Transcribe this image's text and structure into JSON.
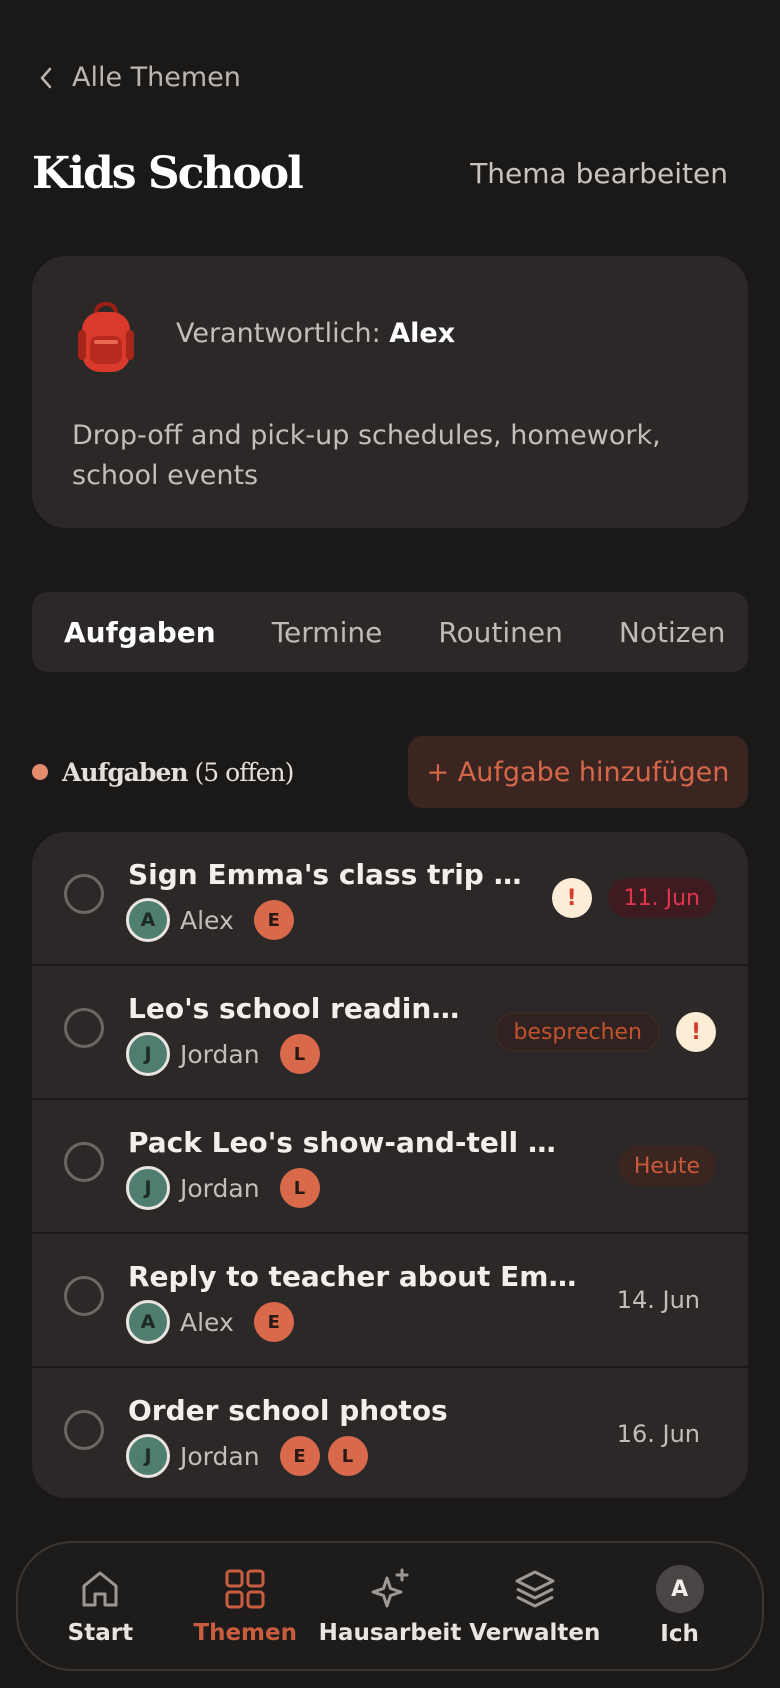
{
  "header": {
    "back_label": "Alle Themen",
    "title": "Kids School",
    "edit_label": "Thema bearbeiten"
  },
  "info": {
    "owner_prefix": "Verantwortlich:",
    "owner_name": "Alex",
    "description": "Drop-off and pick-up schedules, homework, school events",
    "icon": "backpack-icon"
  },
  "tabs": [
    {
      "label": "Aufgaben"
    },
    {
      "label": "Termine"
    },
    {
      "label": "Routinen"
    },
    {
      "label": "Notizen"
    }
  ],
  "section": {
    "title": "Aufgaben",
    "count_label": "(5 offen)",
    "add_label": "+ Aufgabe hinzufügen"
  },
  "tasks": [
    {
      "title": "Sign Emma's class trip permi…",
      "assignee_initial": "A",
      "assignee": "Alex",
      "kids": [
        "E"
      ],
      "warning": "!",
      "badge": "11. Jun"
    },
    {
      "title": "Leo's school readiness …",
      "assignee_initial": "J",
      "assignee": "Jordan",
      "kids": [
        "L"
      ],
      "badge": "besprechen",
      "warning": "!"
    },
    {
      "title": "Pack Leo's show-and-tell toy",
      "assignee_initial": "J",
      "assignee": "Jordan",
      "kids": [
        "L"
      ],
      "badge": "Heute"
    },
    {
      "title": "Reply to teacher about Emma's r…",
      "assignee_initial": "A",
      "assignee": "Alex",
      "kids": [
        "E"
      ],
      "date": "14. Jun"
    },
    {
      "title": "Order school photos",
      "assignee_initial": "J",
      "assignee": "Jordan",
      "kids": [
        "E",
        "L"
      ],
      "date": "16. Jun"
    }
  ],
  "nav": [
    {
      "label": "Start",
      "icon": "home-icon"
    },
    {
      "label": "Themen",
      "icon": "grid-icon"
    },
    {
      "label": "Hausarbeit",
      "icon": "sparkle-icon"
    },
    {
      "label": "Verwalten",
      "icon": "layers-icon"
    },
    {
      "label": "Ich",
      "avatar": "A"
    }
  ],
  "colors": {
    "accent": "#c95d40",
    "background": "#1b1918",
    "card": "#2b2827",
    "assignee": "#4f7d70",
    "kid": "#d9694b"
  }
}
